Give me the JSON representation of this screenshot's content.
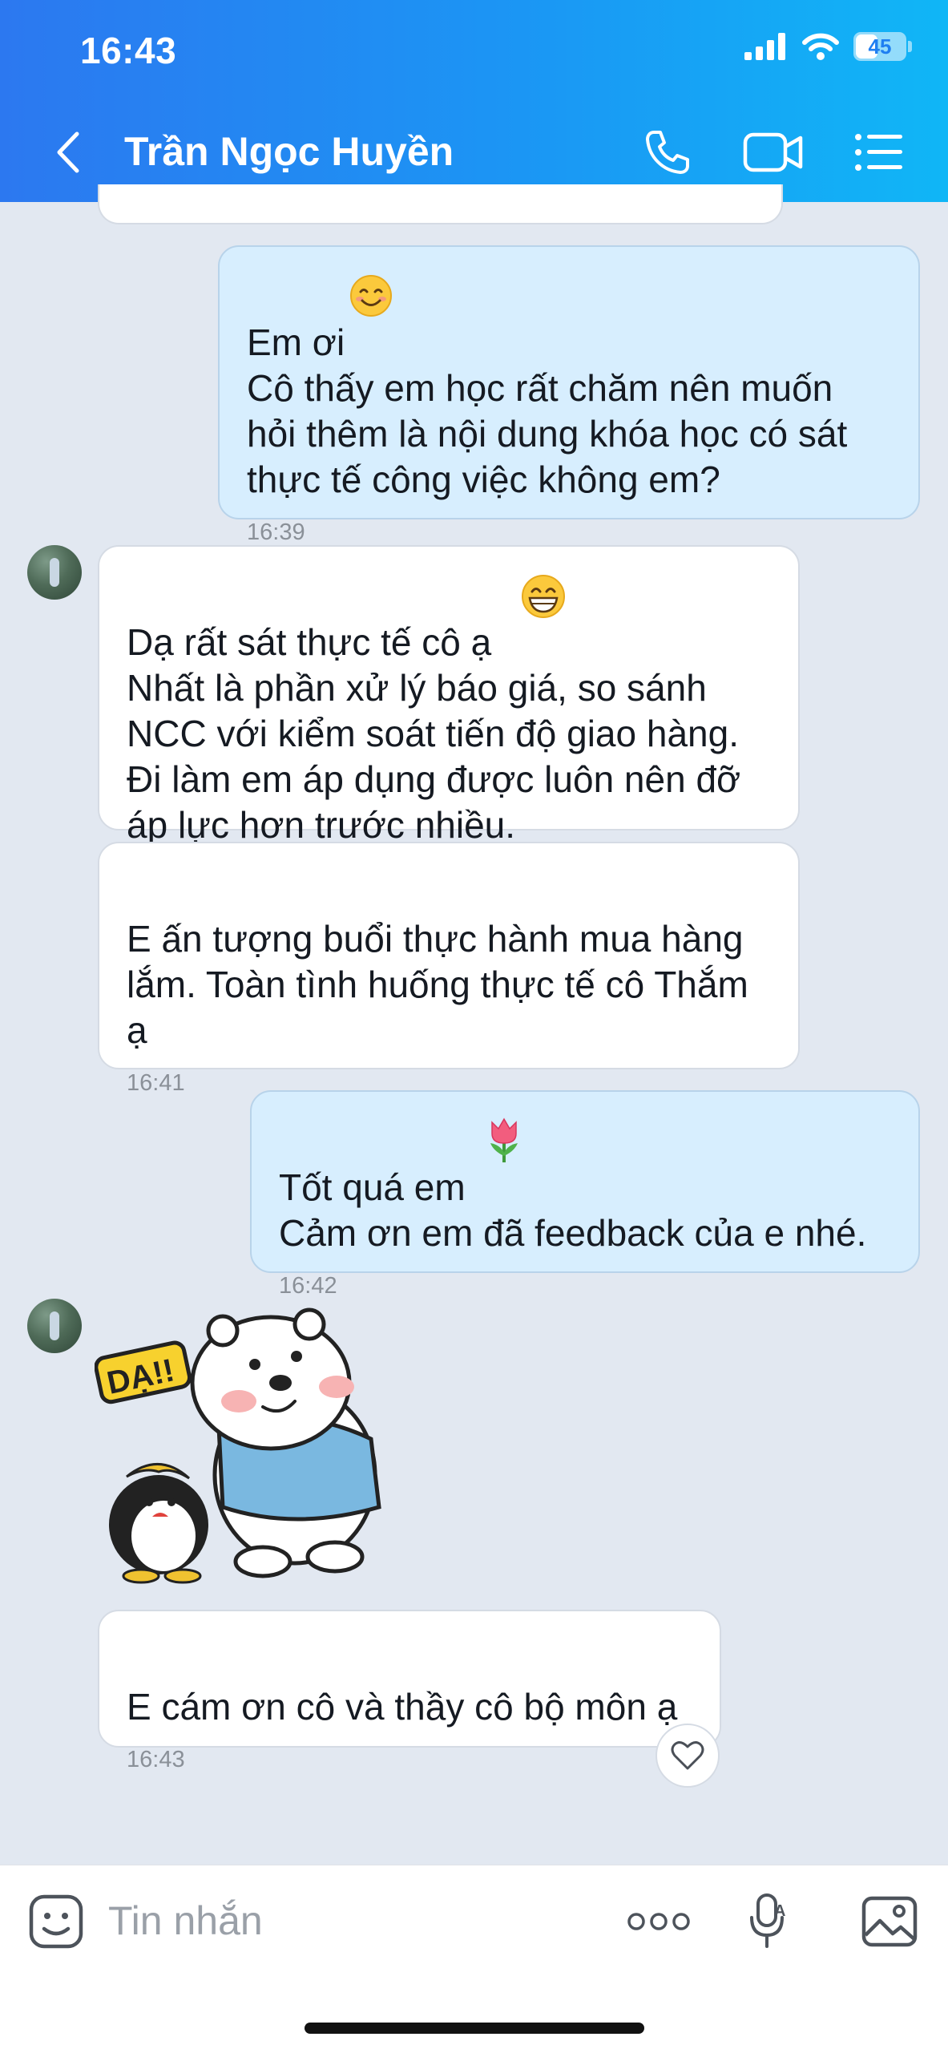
{
  "status_bar": {
    "time": "16:43",
    "battery": "45",
    "battery_level": 0.45
  },
  "header": {
    "title": "Trần Ngọc Huyền",
    "icons": [
      "back-chevron-icon",
      "phone-icon",
      "video-call-icon",
      "menu-list-icon"
    ]
  },
  "messages": [
    {
      "from": "me",
      "text": "Em ơi \nCô thấy em học rất chăm nên muốn hỏi thêm là nội dung khóa học có sát thực tế công việc không em?",
      "time": "16:39",
      "emoji": "smile"
    },
    {
      "from": "contact",
      "text": "Dạ rất sát thực tế cô ạ \nNhất là phần xử lý báo giá, so sánh NCC với kiểm soát tiến độ giao hàng. Đi làm em áp dụng được luôn nên đỡ áp lực hơn trước nhiều.",
      "emoji": "grin"
    },
    {
      "from": "contact",
      "text": "E ấn tượng buổi thực hành mua hàng lắm. Toàn tình huống thực tế cô Thắm ạ",
      "time": "16:41"
    },
    {
      "from": "me",
      "text": "Tốt quá em \nCảm ơn em đã feedback của e nhé.",
      "time": "16:42",
      "emoji": "tulip"
    },
    {
      "from": "contact",
      "sticker": {
        "text": "DẠ!!",
        "description_icons": [
          "polar-bear-icon",
          "penguin-icon"
        ]
      }
    },
    {
      "from": "contact",
      "text": "E cám ơn cô và thầy cô bộ môn ạ",
      "time": "16:43",
      "reaction_button": "heart-icon"
    }
  ],
  "input": {
    "placeholder": "Tin nhắn",
    "icons": [
      "emoji-sticker-icon",
      "more-dots-icon",
      "voice-mic-icon",
      "image-gallery-icon"
    ]
  },
  "colors": {
    "header_start": "#2c78f0",
    "header_end": "#10b6f6",
    "bg": "#e2e8f1",
    "bubble_out": "#d7eefe",
    "bubble_in": "#ffffff"
  }
}
